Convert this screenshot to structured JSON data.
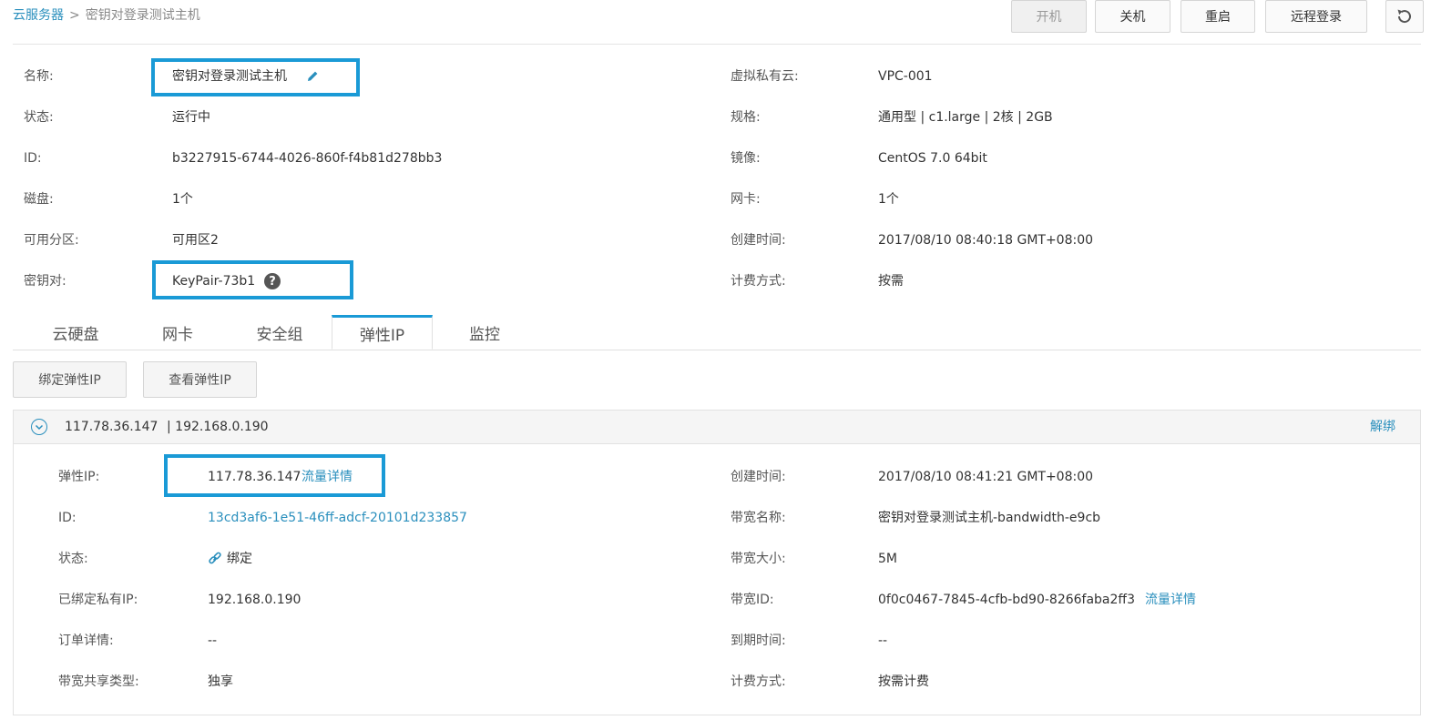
{
  "breadcrumb": {
    "root": "云服务器",
    "separator": ">",
    "current": "密钥对登录测试主机"
  },
  "toolbar": {
    "start": "开机",
    "stop": "关机",
    "restart": "重启",
    "remote_login": "远程登录"
  },
  "info_left": [
    {
      "label": "名称:",
      "value": "密钥对登录测试主机"
    },
    {
      "label": "状态:",
      "value": "运行中"
    },
    {
      "label": "ID:",
      "value": "b3227915-6744-4026-860f-f4b81d278bb3"
    },
    {
      "label": "磁盘:",
      "value": "1个"
    },
    {
      "label": "可用分区:",
      "value": "可用区2"
    },
    {
      "label": "密钥对:",
      "value": "KeyPair-73b1"
    }
  ],
  "info_right": [
    {
      "label": "虚拟私有云:",
      "value": "VPC-001"
    },
    {
      "label": "规格:",
      "value": "通用型 | c1.large | 2核 | 2GB"
    },
    {
      "label": "镜像:",
      "value": "CentOS 7.0 64bit"
    },
    {
      "label": "网卡:",
      "value": "1个"
    },
    {
      "label": "创建时间:",
      "value": "2017/08/10 08:40:18 GMT+08:00"
    },
    {
      "label": "计费方式:",
      "value": "按需"
    }
  ],
  "tabs": [
    "云硬盘",
    "网卡",
    "安全组",
    "弹性IP",
    "监控"
  ],
  "actions": {
    "bind": "绑定弹性IP",
    "view": "查看弹性IP"
  },
  "eip": {
    "header": {
      "ip": "117.78.36.147",
      "private": "| 192.168.0.190",
      "unbind": "解绑"
    },
    "left": [
      {
        "label": "弹性IP:",
        "value": "117.78.36.147",
        "link": "流量详情"
      },
      {
        "label": "ID:",
        "value": "13cd3af6-1e51-46ff-adcf-20101d233857"
      },
      {
        "label": "状态:",
        "value": "绑定"
      },
      {
        "label": "已绑定私有IP:",
        "value": "192.168.0.190"
      },
      {
        "label": "订单详情:",
        "value": "--"
      },
      {
        "label": "带宽共享类型:",
        "value": "独享"
      }
    ],
    "right": [
      {
        "label": "创建时间:",
        "value": "2017/08/10 08:41:21 GMT+08:00"
      },
      {
        "label": "带宽名称:",
        "value": "密钥对登录测试主机-bandwidth-e9cb"
      },
      {
        "label": "带宽大小:",
        "value": "5M"
      },
      {
        "label": "带宽ID:",
        "value": "0f0c0467-7845-4cfb-bd90-8266faba2ff3",
        "link": "流量详情"
      },
      {
        "label": "到期时间:",
        "value": "--"
      },
      {
        "label": "计费方式:",
        "value": "按需计费"
      }
    ]
  },
  "colors": {
    "accent": "#1a9ad6",
    "link": "#2a8fbd"
  }
}
